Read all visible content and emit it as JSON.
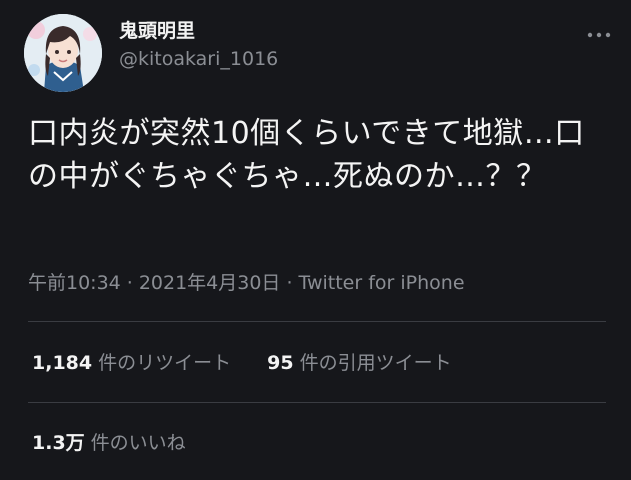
{
  "user": {
    "display_name": "鬼頭明里",
    "handle": "@kitoakari_1016",
    "avatar_icon": "profile-photo"
  },
  "tweet": {
    "text": "口内炎が突然10個くらいできて地獄…口の中がぐちゃぐちゃ…死ぬのか…？？",
    "time": "午前10:34",
    "date": "2021年4月30日",
    "separator": "·",
    "client": "Twitter for iPhone"
  },
  "stats": {
    "retweets_count": "1,184",
    "retweets_label": "件のリツイート",
    "quotes_count": "95",
    "quotes_label": "件の引用ツイート",
    "likes_count": "1.3万",
    "likes_label": "件のいいね"
  },
  "colors": {
    "background": "#16171b",
    "text": "#f4f4f4",
    "secondary": "#8b8e94",
    "divider": "#3a3c42"
  }
}
